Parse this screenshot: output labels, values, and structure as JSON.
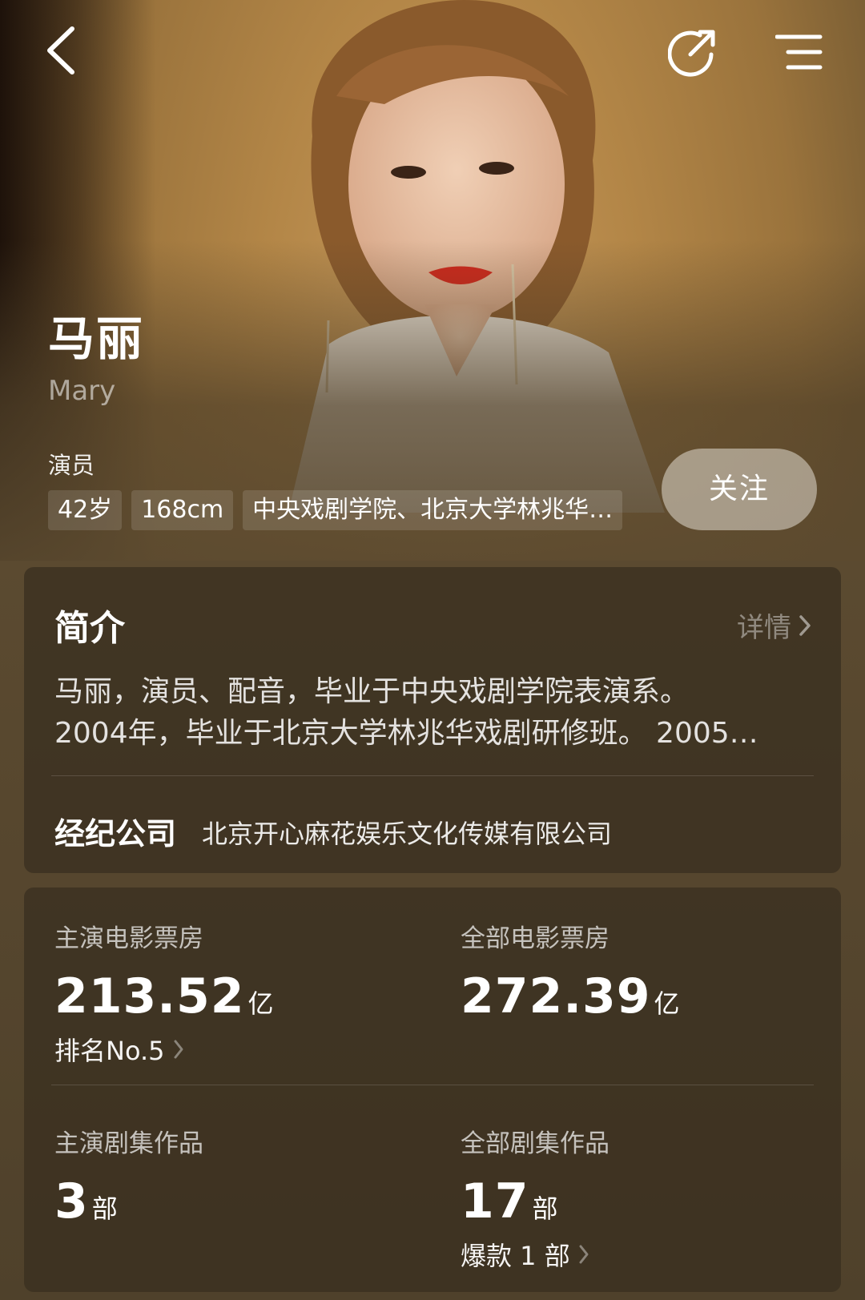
{
  "profile": {
    "name": "马丽",
    "english_name": "Mary",
    "role": "演员",
    "tags": [
      "42岁",
      "168cm",
      "中央戏剧学院、北京大学林兆华…"
    ],
    "follow_label": "关注"
  },
  "icons": [
    "back-arrow-icon",
    "share-icon",
    "menu-icon",
    "chevron-right-icon"
  ],
  "intro": {
    "title": "简介",
    "more_label": "详情",
    "text_lines": [
      "马丽，演员、配音，毕业于中央戏剧学院表演系。",
      "2004年，毕业于北京大学林兆华戏剧研修班。 2005…"
    ],
    "agency_label": "经纪公司",
    "agency_value": "北京开心麻花娱乐文化传媒有限公司"
  },
  "stats": {
    "lead_box_office": {
      "label": "主演电影票房",
      "value": "213.52",
      "unit": "亿",
      "sub": "排名No.5"
    },
    "total_box_office": {
      "label": "全部电影票房",
      "value": "272.39",
      "unit": "亿"
    },
    "lead_series": {
      "label": "主演剧集作品",
      "value": "3",
      "unit": "部"
    },
    "total_series": {
      "label": "全部剧集作品",
      "value": "17",
      "unit": "部",
      "sub": "爆款 1 部"
    }
  }
}
